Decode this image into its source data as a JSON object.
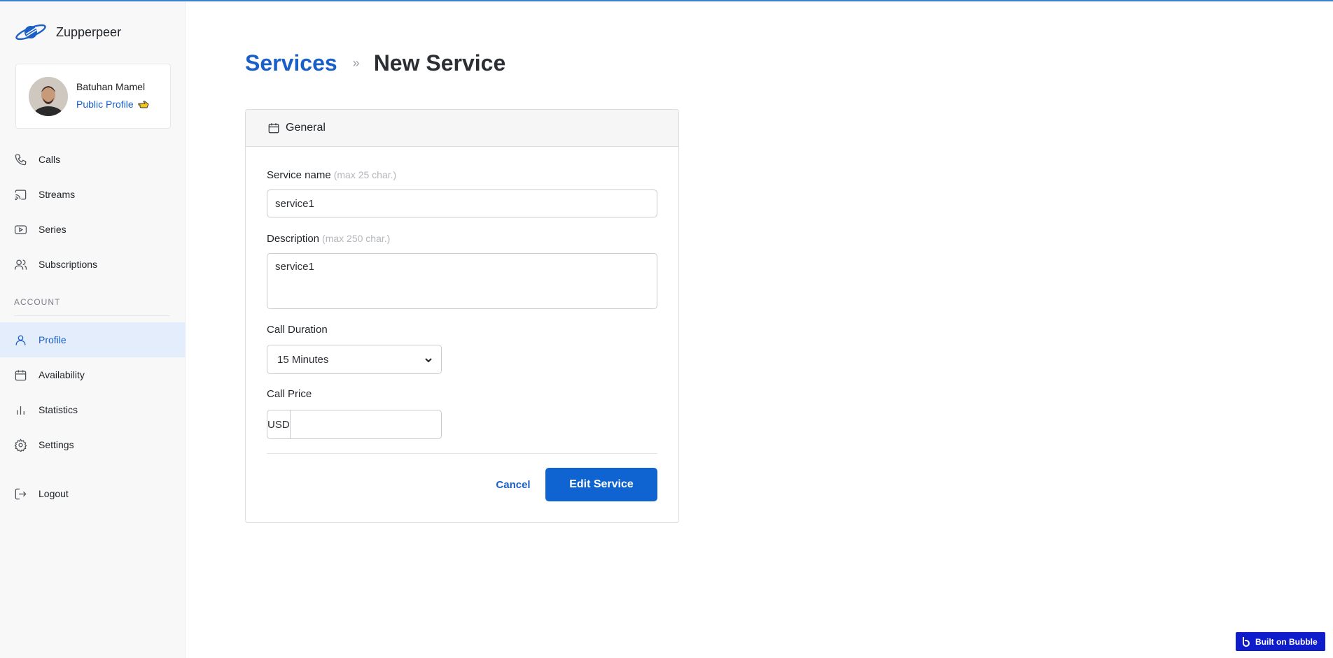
{
  "app": {
    "name": "Zupperpeer",
    "brand_color": "#1a5fc8",
    "primary_button_color": "#1064d2"
  },
  "user": {
    "name": "Batuhan Mamel",
    "public_profile_label": "Public Profile"
  },
  "sidebar": {
    "items": [
      {
        "label": "Calls",
        "icon": "phone-icon"
      },
      {
        "label": "Streams",
        "icon": "cast-icon"
      },
      {
        "label": "Series",
        "icon": "play-icon"
      },
      {
        "label": "Subscriptions",
        "icon": "users-icon"
      }
    ],
    "account_section_label": "ACCOUNT",
    "account_items": [
      {
        "label": "Profile",
        "icon": "user-icon",
        "active": true
      },
      {
        "label": "Availability",
        "icon": "calendar-icon"
      },
      {
        "label": "Statistics",
        "icon": "bar-chart-icon"
      },
      {
        "label": "Settings",
        "icon": "gear-icon"
      }
    ],
    "logout_label": "Logout"
  },
  "breadcrumb": {
    "parent": "Services",
    "separator": "»",
    "current": "New Service"
  },
  "form": {
    "section_title": "General",
    "service_name": {
      "label": "Service name",
      "hint": "(max 25 char.)",
      "value": "service1"
    },
    "description": {
      "label": "Description",
      "hint": "(max 250 char.)",
      "value": "service1"
    },
    "call_duration": {
      "label": "Call Duration",
      "selected": "15 Minutes"
    },
    "call_price": {
      "label": "Call Price",
      "currency": "USD",
      "value": ""
    },
    "cancel_label": "Cancel",
    "submit_label": "Edit Service"
  },
  "badge": {
    "label": "Built on Bubble"
  }
}
